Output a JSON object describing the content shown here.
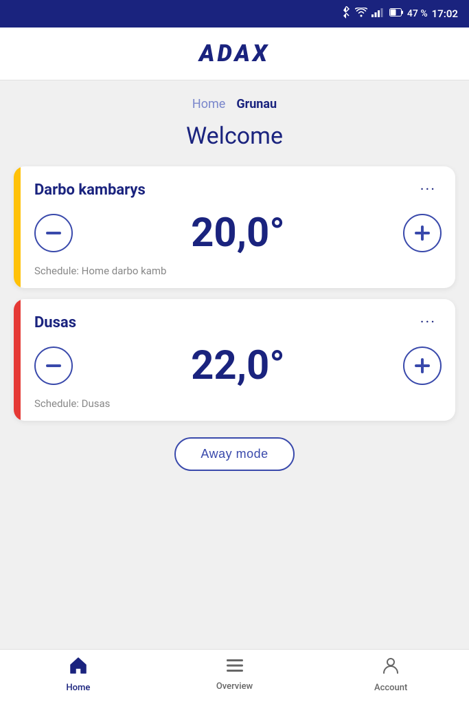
{
  "statusBar": {
    "battery": "47 %",
    "time": "17:02",
    "icons": [
      "bluetooth",
      "wifi",
      "signal",
      "battery"
    ]
  },
  "header": {
    "logo": "ADAX"
  },
  "breadcrumb": {
    "home": "Home",
    "current": "Grunau"
  },
  "welcome": {
    "title": "Welcome"
  },
  "devices": [
    {
      "id": "darbo-kambarys",
      "name": "Darbo kambarys",
      "temperature": "20,0°",
      "schedule": "Schedule: Home darbo kamb",
      "indicator": "yellow"
    },
    {
      "id": "dusas",
      "name": "Dusas",
      "temperature": "22,0°",
      "schedule": "Schedule: Dusas",
      "indicator": "red"
    }
  ],
  "awayMode": {
    "label": "Away mode"
  },
  "bottomNav": {
    "items": [
      {
        "id": "home",
        "label": "Home",
        "active": true
      },
      {
        "id": "overview",
        "label": "Overview",
        "active": false
      },
      {
        "id": "account",
        "label": "Account",
        "active": false
      }
    ]
  }
}
